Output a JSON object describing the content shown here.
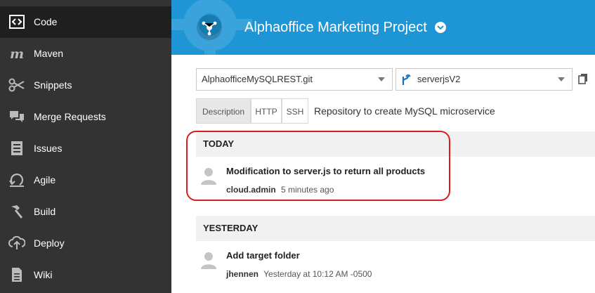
{
  "sidebar": {
    "items": [
      {
        "label": "Code",
        "icon": "code-icon",
        "active": true
      },
      {
        "label": "Maven",
        "icon": "maven-icon"
      },
      {
        "label": "Snippets",
        "icon": "scissors-icon"
      },
      {
        "label": "Merge Requests",
        "icon": "merge-requests-icon"
      },
      {
        "label": "Issues",
        "icon": "issues-icon"
      },
      {
        "label": "Agile",
        "icon": "agile-icon"
      },
      {
        "label": "Build",
        "icon": "hammer-icon"
      },
      {
        "label": "Deploy",
        "icon": "cloud-upload-icon"
      },
      {
        "label": "Wiki",
        "icon": "document-icon"
      }
    ]
  },
  "header": {
    "project_title": "Alphaoffice Marketing Project"
  },
  "repo": {
    "repository": "AlphaofficeMySQLREST.git",
    "branch": "serverjsV2"
  },
  "tabs": {
    "items": [
      "Description",
      "HTTP",
      "SSH"
    ],
    "active": "Description",
    "description_text": "Repository to create MySQL microservice"
  },
  "commits": {
    "groups": [
      {
        "label": "TODAY",
        "entries": [
          {
            "message": "Modification to server.js to return all products",
            "author": "cloud.admin",
            "time": "5 minutes ago"
          }
        ]
      },
      {
        "label": "YESTERDAY",
        "entries": [
          {
            "message": "Add target folder",
            "author": "jhennen",
            "time": "Yesterday at 10:12 AM -0500"
          }
        ]
      }
    ]
  },
  "colors": {
    "sidebar_bg": "#333333",
    "header_bg": "#1e96d6",
    "highlight": "#d81e1e"
  }
}
